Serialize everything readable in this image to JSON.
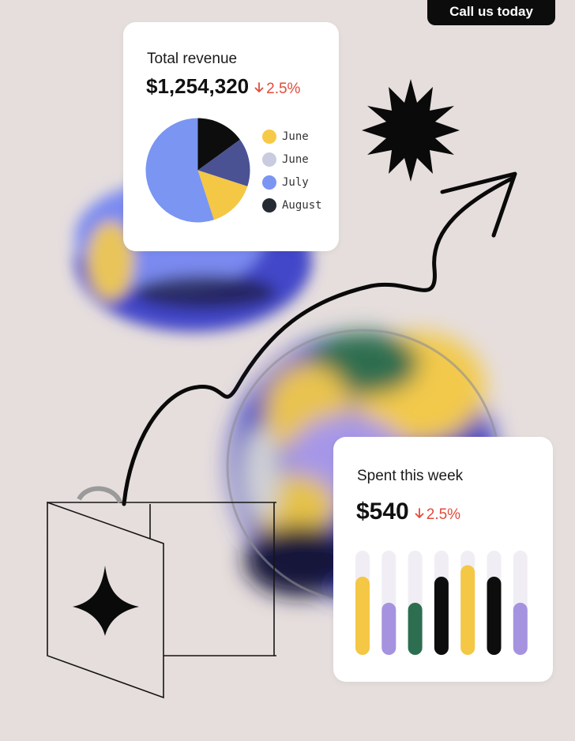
{
  "header": {
    "cta_label": "Call us today"
  },
  "revenue_card": {
    "title": "Total revenue",
    "amount": "$1,254,320",
    "change": "2.5%",
    "legend": [
      {
        "label": "June",
        "color": "#f7c948"
      },
      {
        "label": "June",
        "color": "#c9cbe0"
      },
      {
        "label": "July",
        "color": "#7a95f2"
      },
      {
        "label": "August",
        "color": "#262a33"
      }
    ]
  },
  "spent_card": {
    "title": "Spent this week",
    "amount": "$540",
    "change": "2.5%"
  },
  "colors": {
    "background": "#e6dedd",
    "negative": "#e24b3c",
    "track": "#f0eef4",
    "yellow": "#f4c745",
    "lavender": "#a593e0",
    "green": "#2c6e4f",
    "black": "#0d0d0d",
    "blue_pie": "#7a95f2",
    "navy_pie": "#4a5294"
  },
  "chart_data": [
    {
      "type": "pie",
      "slices": [
        {
          "color": "#0d0d0d",
          "value": 0.15
        },
        {
          "color": "#4a5294",
          "value": 0.15
        },
        {
          "color": "#f4c745",
          "value": 0.15
        },
        {
          "color": "#7a95f2",
          "value": 0.55
        }
      ]
    },
    {
      "type": "bar",
      "values": [
        0.75,
        0.5,
        0.5,
        0.75,
        0.86,
        0.75,
        0.5
      ],
      "colors": [
        "#f4c745",
        "#a593e0",
        "#2c6e4f",
        "#0d0d0d",
        "#f4c745",
        "#0d0d0d",
        "#a593e0"
      ],
      "ylim": [
        0,
        1
      ]
    }
  ]
}
